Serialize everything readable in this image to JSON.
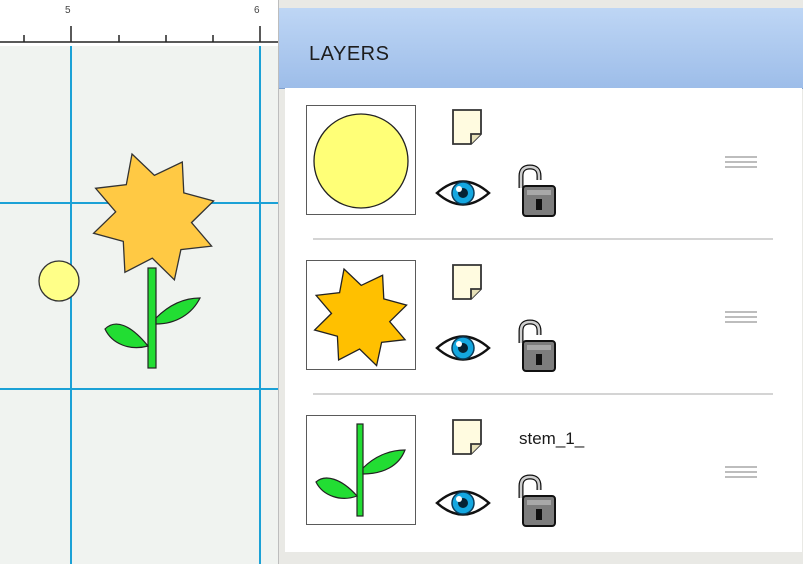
{
  "ruler": {
    "tick_labels": [
      "5",
      "6"
    ]
  },
  "layers_panel": {
    "title": "LAYERS",
    "layers": [
      {
        "thumbnail": "circle",
        "name": "",
        "fill": "#ffff77",
        "visible": true,
        "locked": false
      },
      {
        "thumbnail": "star",
        "name": "",
        "fill": "#ffc000",
        "visible": true,
        "locked": false
      },
      {
        "thumbnail": "stem",
        "name": "stem_1_",
        "fill": "#22dd33",
        "visible": true,
        "locked": false
      }
    ]
  },
  "icons": {
    "layer_note": "note-icon",
    "visibility": "eye-icon",
    "lock": "unlocked-padlock-icon",
    "reorder": "drag-handle-icon"
  },
  "colors": {
    "guide_line": "#1ba1d6",
    "panel_header": "#a9c6ef",
    "artboard_bg": "#f0f3f0",
    "circle_fill": "#ffff88",
    "star_fill": "#ffc944",
    "leaf_fill": "#22dd33",
    "eye_iris": "#14a7e0"
  }
}
